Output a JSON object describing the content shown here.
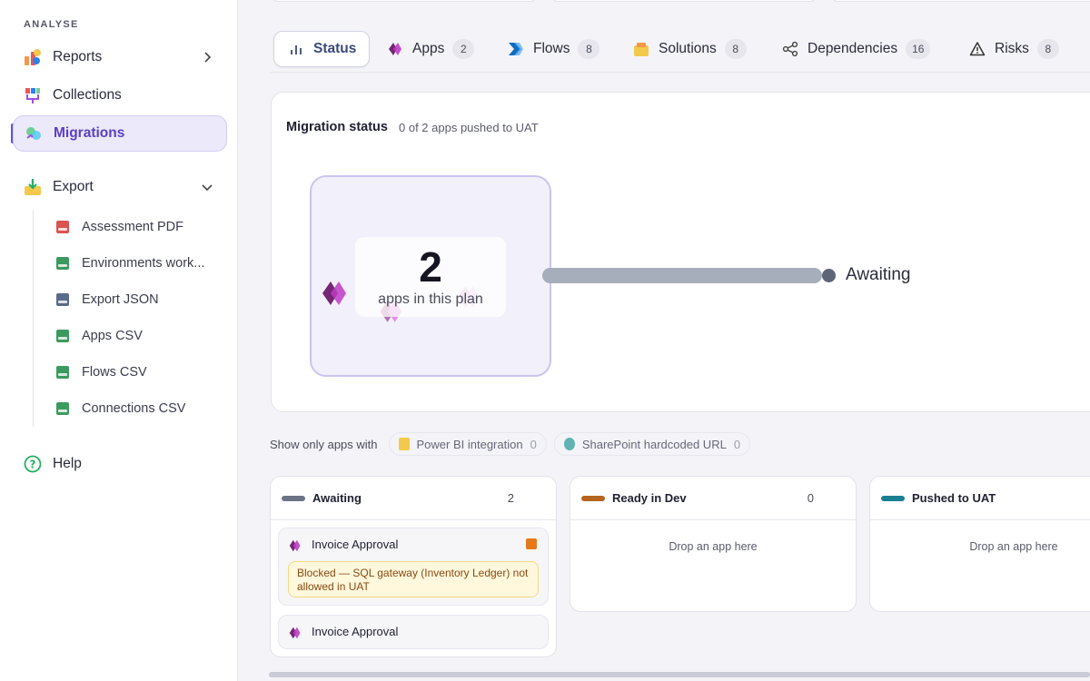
{
  "sidebar": {
    "section_label": "ANALYSE",
    "items": [
      {
        "label": "Reports",
        "icon": "reports-icon"
      },
      {
        "label": "Collections",
        "icon": "collections-icon"
      },
      {
        "label": "Migrations",
        "icon": "migrations-icon",
        "active": true
      }
    ],
    "export": {
      "label": "Export",
      "items": [
        {
          "label": "Assessment PDF",
          "color": "#d9534f"
        },
        {
          "label": "Environments work...",
          "color": "#3c9a5f"
        },
        {
          "label": "Export JSON",
          "color": "#5a6a8a"
        },
        {
          "label": "Apps CSV",
          "color": "#3c9a5f"
        },
        {
          "label": "Flows CSV",
          "color": "#3c9a5f"
        },
        {
          "label": "Connections CSV",
          "color": "#3c9a5f"
        }
      ]
    },
    "help": "Help"
  },
  "tabs": [
    {
      "label": "Status",
      "active": true
    },
    {
      "label": "Apps",
      "count": "2"
    },
    {
      "label": "Flows",
      "count": "8"
    },
    {
      "label": "Solutions",
      "count": "8"
    },
    {
      "label": "Dependencies",
      "count": "16"
    },
    {
      "label": "Risks",
      "count": "8"
    }
  ],
  "status": {
    "title": "Migration status",
    "subtitle": "0 of 2 apps pushed to UAT",
    "count": "2",
    "count_label": "apps in this plan",
    "stage_label": "Awaiting"
  },
  "filters": {
    "label": "Show only apps with",
    "chips": [
      {
        "label": "Power BI integration",
        "count": "0",
        "color": "#f2c94c"
      },
      {
        "label": "SharePoint hardcoded URL",
        "count": "0",
        "color": "#5fb3b3"
      }
    ]
  },
  "columns": [
    {
      "title": "Awaiting",
      "count": "2",
      "color": "#6b7385"
    },
    {
      "title": "Ready in Dev",
      "count": "0",
      "color": "#b5651d",
      "empty": "Drop an app here"
    },
    {
      "title": "Pushed to UAT",
      "count": "",
      "color": "#1a7f93",
      "empty": "Drop an app here"
    }
  ],
  "awaiting_apps": [
    {
      "name": "Invoice Approval",
      "blocked": "Blocked — SQL gateway (Inventory Ledger) not allowed in UAT"
    },
    {
      "name": "Invoice Approval"
    }
  ],
  "colors": {
    "accent": "#6a4fd8",
    "power_apps": "#9b3a8c"
  }
}
